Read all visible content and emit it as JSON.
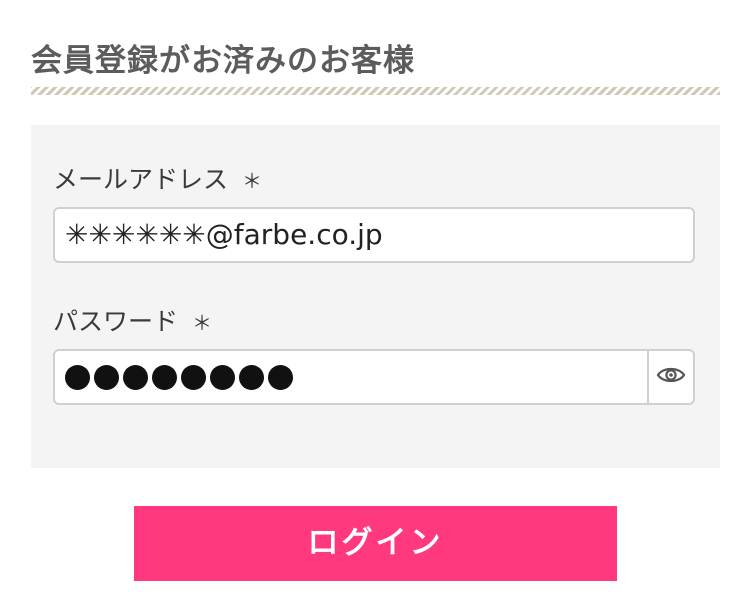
{
  "section": {
    "title": "会員登録がお済みのお客様"
  },
  "form": {
    "email": {
      "label": "メールアドレス",
      "required_mark": "＊",
      "value": "✳✳✳✳✳✳@farbe.co.jp"
    },
    "password": {
      "label": "パスワード",
      "required_mark": "＊",
      "masked_length": 8,
      "toggle_icon": "eye-icon"
    }
  },
  "login_button": {
    "label": "ログイン"
  },
  "colors": {
    "title_text": "#5c5c5c",
    "divider_stripe": "#cfcab6",
    "panel_background": "#f4f4f4",
    "input_border": "#d0d0d0",
    "login_button_background": "#ff3880",
    "login_button_text": "#ffffff"
  }
}
